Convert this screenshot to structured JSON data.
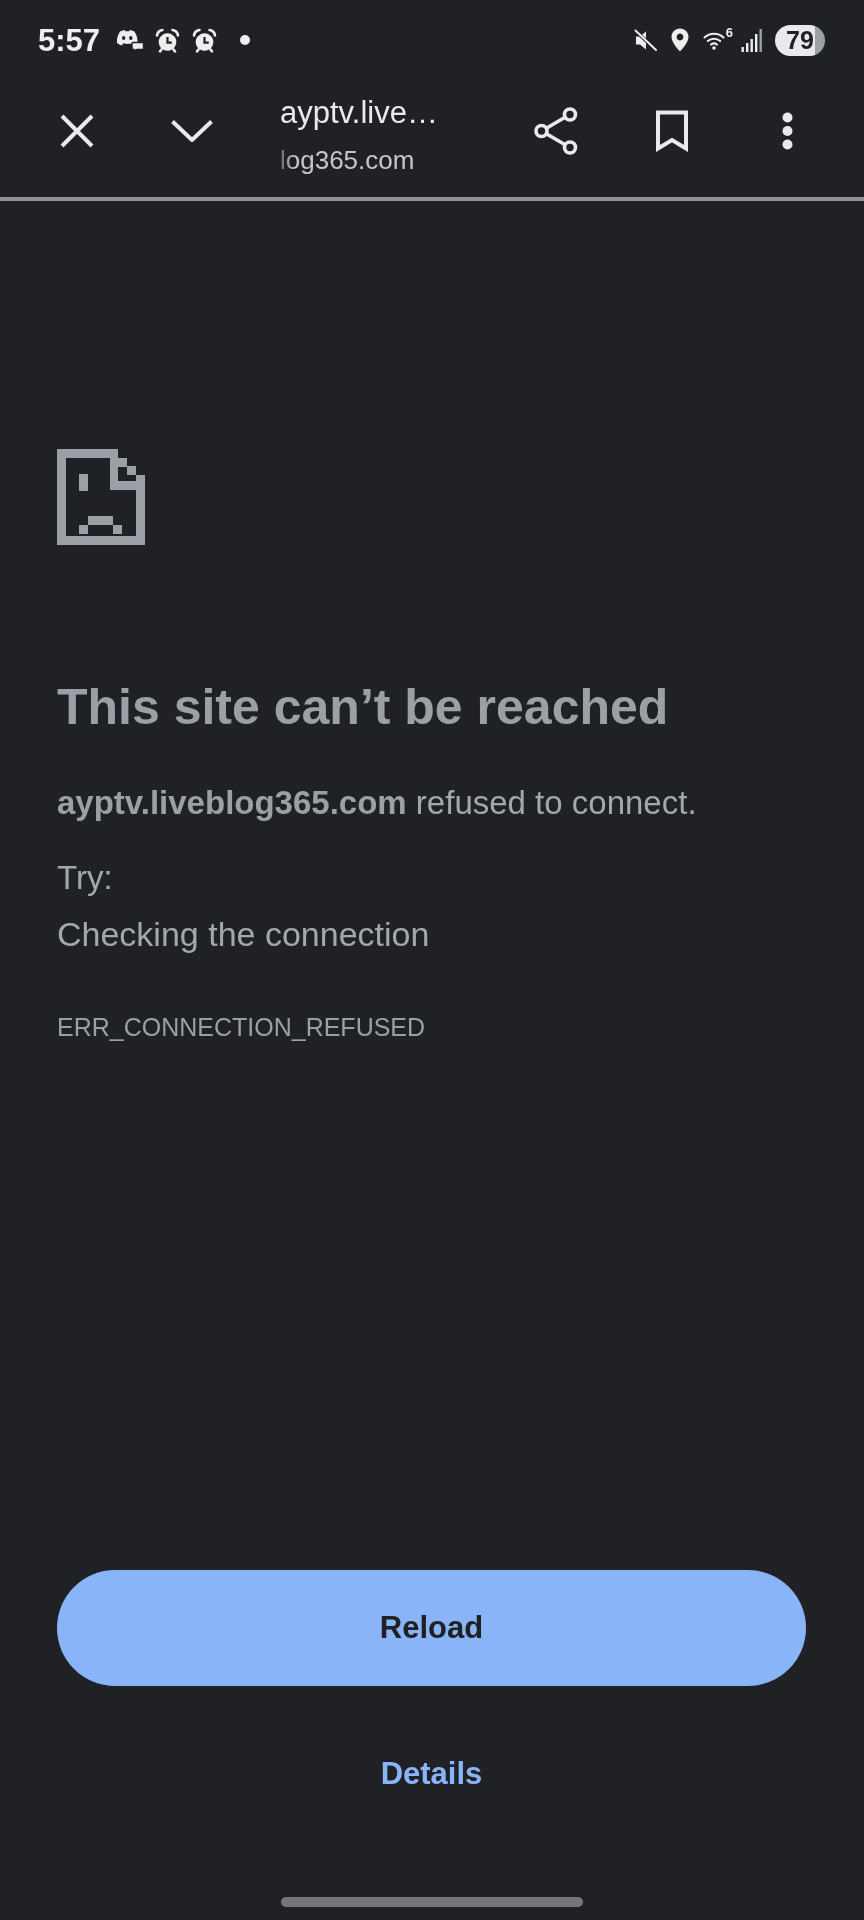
{
  "status_bar": {
    "time": "5:57",
    "wifi_badge": "6",
    "battery": "79"
  },
  "toolbar": {
    "title": "ayptv.live…",
    "url": "log365.com"
  },
  "error_page": {
    "heading": "This site can’t be reached",
    "message": "**ayptv.liveblog365.com** refused to connect.",
    "try_label": "Try:",
    "suggestions": [
      "Checking the connection"
    ],
    "error_code": "ERR_CONNECTION_REFUSED"
  },
  "buttons": [
    {
      "label": "Reload",
      "kind": "primary"
    },
    {
      "label": "Details",
      "kind": "text"
    }
  ]
}
